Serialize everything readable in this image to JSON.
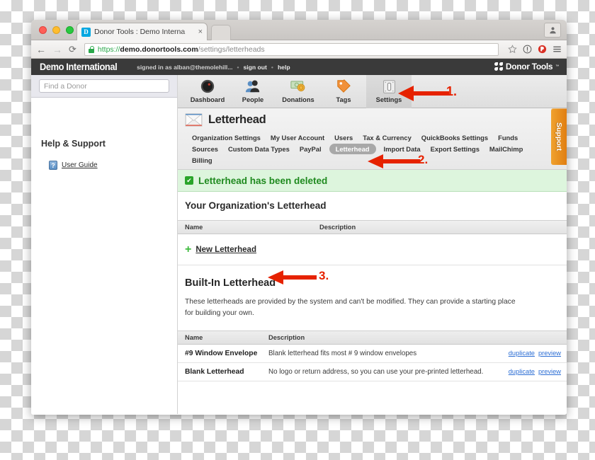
{
  "browser": {
    "tab": {
      "title": "Donor Tools : Demo Interna",
      "favicon_letter": "D",
      "close_label": "×"
    },
    "nav": {
      "back": "←",
      "forward": "→",
      "reload": "⟳"
    },
    "url": {
      "scheme": "https://",
      "host": "demo.donortools.com",
      "path": "/settings/letterheads"
    },
    "icons": [
      "star-icon",
      "info-icon",
      "adblock-icon",
      "menu-icon",
      "profile-icon"
    ]
  },
  "appbar": {
    "brand": "Demo International",
    "signed_in_as": "signed in as alban@themolehill...",
    "separator": "•",
    "sign_out": "sign out",
    "help": "help",
    "product_name": "Donor Tools",
    "trademark": "™"
  },
  "sidebar": {
    "search_placeholder": "Find a Donor",
    "search_value": "",
    "help_title": "Help & Support",
    "help_items": [
      {
        "label": "User Guide",
        "icon": "book-help-icon"
      }
    ]
  },
  "navtabs": [
    {
      "label": "Dashboard",
      "icon": "gauge-icon",
      "active": false
    },
    {
      "label": "People",
      "icon": "person-icon",
      "active": false
    },
    {
      "label": "Donations",
      "icon": "money-icon",
      "active": false
    },
    {
      "label": "Tags",
      "icon": "tag-icon",
      "active": false
    },
    {
      "label": "Settings",
      "icon": "switch-icon",
      "active": true
    }
  ],
  "page": {
    "title": "Letterhead",
    "icon": "envelope-icon"
  },
  "subnav": [
    {
      "label": "Organization Settings",
      "current": false
    },
    {
      "label": "My User Account",
      "current": false
    },
    {
      "label": "Users",
      "current": false
    },
    {
      "label": "Tax & Currency",
      "current": false
    },
    {
      "label": "QuickBooks Settings",
      "current": false
    },
    {
      "label": "Funds",
      "current": false
    },
    {
      "label": "Sources",
      "current": false
    },
    {
      "label": "Custom Data Types",
      "current": false
    },
    {
      "label": "PayPal",
      "current": false
    },
    {
      "label": "Letterhead",
      "current": true
    },
    {
      "label": "Import Data",
      "current": false
    },
    {
      "label": "Export Settings",
      "current": false
    },
    {
      "label": "MailChimp",
      "current": false
    },
    {
      "label": "Billing",
      "current": false
    }
  ],
  "flash": {
    "message": "Letterhead has been deleted",
    "icon": "checkbox-checked-icon",
    "check_glyph": "✔"
  },
  "org_section": {
    "title": "Your Organization's Letterhead",
    "columns": [
      "Name",
      "Description"
    ],
    "new_link": "New Letterhead",
    "plus_glyph": "+"
  },
  "builtin_section": {
    "title": "Built-In Letterhead",
    "description": "These letterheads are provided by the system and can't be modified. They can provide a starting place for building your own.",
    "columns": [
      "Name",
      "Description"
    ],
    "rows": [
      {
        "name": "#9 Window Envelope",
        "description": "Blank letterhead fits most # 9 window envelopes",
        "actions": [
          "duplicate",
          "preview"
        ]
      },
      {
        "name": "Blank Letterhead",
        "description": "No logo or return address, so you can use your pre-printed letterhead.",
        "actions": [
          "duplicate",
          "preview"
        ]
      }
    ]
  },
  "support_tab": {
    "label": "Support"
  },
  "annotations": [
    {
      "number": "1.",
      "target": "settings-tab"
    },
    {
      "number": "2.",
      "target": "letterhead-subnav-link"
    },
    {
      "number": "3.",
      "target": "new-letterhead-link"
    }
  ],
  "colors": {
    "annotation_red": "#e62200",
    "flash_green_bg": "#ddf5dd",
    "flash_green_text": "#1f8a1f",
    "link_blue": "#2b6dd4",
    "support_orange": "#e07e12",
    "appbar_dark": "#3a3a3a",
    "plus_green": "#3fbb3f"
  }
}
